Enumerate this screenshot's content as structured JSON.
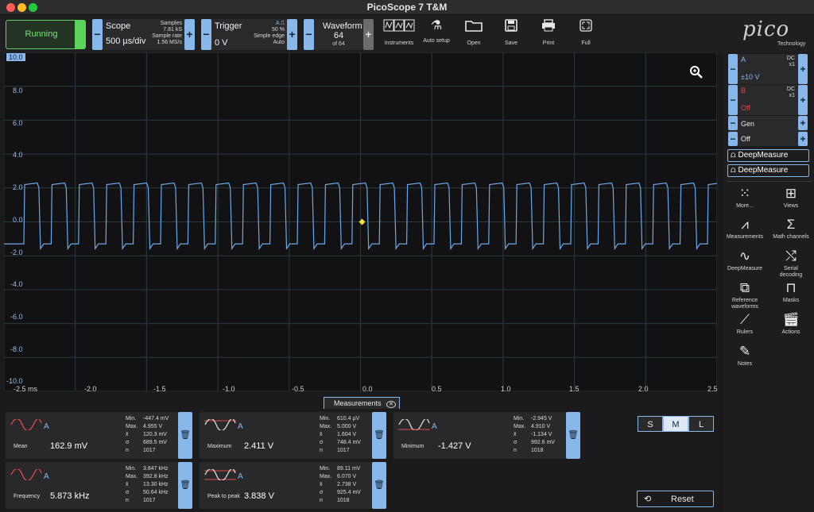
{
  "window": {
    "title": "PicoScope 7 T&M"
  },
  "status": {
    "running_label": "Running"
  },
  "scope": {
    "label": "Scope",
    "timebase": "500 µs/div",
    "samples_label": "Samples",
    "samples_value": "7.81 kS",
    "rate_label": "Sample rate",
    "rate_value": "1.56 MS/s"
  },
  "trigger": {
    "label": "Trigger",
    "level": "0 V",
    "percent": "50 %",
    "mode": "Simple edge",
    "type": "Auto",
    "channel": "A"
  },
  "waveform": {
    "label": "Waveform",
    "current": "64",
    "total": "of 64"
  },
  "tools": [
    {
      "label": "Instruments",
      "icon": "instruments-icon"
    },
    {
      "label": "Auto setup",
      "icon": "wand-icon"
    },
    {
      "label": "Open",
      "icon": "folder-icon"
    },
    {
      "label": "Save",
      "icon": "save-icon"
    },
    {
      "label": "Print",
      "icon": "print-icon"
    },
    {
      "label": "Full",
      "icon": "fullscreen-icon"
    }
  ],
  "logo": {
    "brand": "pico",
    "sub": "Technology"
  },
  "plot": {
    "ytop_marker": "10.0",
    "ybottom_marker": "-10.0",
    "y_ticks": [
      "8.0",
      "6.0",
      "4.0",
      "2.0",
      "0.0",
      "-2.0",
      "-4.0",
      "-6.0",
      "-8.0"
    ],
    "x_ticks": [
      "-2.5 ms",
      "-2.0",
      "-1.5",
      "-1.0",
      "-0.5",
      "0.0",
      "0.5",
      "1.0",
      "1.5",
      "2.0",
      "2.5"
    ],
    "trace_color": "#6fa8e6",
    "grid_color": "#2a3a40",
    "trigger_marker_color": "#f2e24a"
  },
  "channels": {
    "a": {
      "name": "A",
      "coupling": "DC",
      "probe": "x1",
      "range": "±10 V",
      "color": "#8ab7ea"
    },
    "b": {
      "name": "B",
      "coupling": "DC",
      "probe": "x1",
      "range": "Off",
      "color": "#e04a4a"
    },
    "gen": {
      "name": "Gen",
      "state": "Off"
    }
  },
  "deep": [
    "DeepMeasure",
    "DeepMeasure"
  ],
  "right_tools": [
    {
      "label": "More...",
      "icon": "grid-dots-icon"
    },
    {
      "label": "Views",
      "icon": "views-icon"
    },
    {
      "label": "Measurements",
      "icon": "compass-icon"
    },
    {
      "label": "Math channels",
      "icon": "sigma-icon"
    },
    {
      "label": "DeepMeasure",
      "icon": "deepmeasure-icon"
    },
    {
      "label": "Serial decoding",
      "icon": "serial-icon"
    },
    {
      "label": "Reference waveforms",
      "icon": "reference-icon"
    },
    {
      "label": "Masks",
      "icon": "mask-icon"
    },
    {
      "label": "Rulers",
      "icon": "ruler-icon"
    },
    {
      "label": "Actions",
      "icon": "clapper-icon"
    },
    {
      "label": "Notes",
      "icon": "notes-icon"
    }
  ],
  "measurements_tab": "Measurements",
  "measurements": [
    {
      "name": "Mean",
      "value": "162.9 mV",
      "ch": "A",
      "min": "-447.4 mV",
      "max": "4.955 V",
      "avg": "120.3 mV",
      "sd": "689.5 mV",
      "n": "1017"
    },
    {
      "name": "Maximum",
      "value": "2.411 V",
      "ch": "A",
      "min": "610.4 µV",
      "max": "5.000 V",
      "avg": "1.604 V",
      "sd": "748.4 mV",
      "n": "1017"
    },
    {
      "name": "Minimum",
      "value": "-1.427 V",
      "ch": "A",
      "min": "-2.945 V",
      "max": "4.910 V",
      "avg": "-1.134 V",
      "sd": "992.6 mV",
      "n": "1018"
    },
    {
      "name": "Frequency",
      "value": "5.873 kHz",
      "ch": "A",
      "min": "3.847 kHz",
      "max": "392.8 kHz",
      "avg": "13.30 kHz",
      "sd": "50.64 kHz",
      "n": "1017"
    },
    {
      "name": "Peak to peak",
      "value": "3.838 V",
      "ch": "A",
      "min": "89.11 mV",
      "max": "6.070 V",
      "avg": "2.738 V",
      "sd": "925.4 mV",
      "n": "1018"
    }
  ],
  "stat_keys": {
    "min": "Min.",
    "max": "Max.",
    "avg": "x̄",
    "sd": "σ",
    "n": "n"
  },
  "size_buttons": [
    "S",
    "M",
    "L"
  ],
  "reset_label": "Reset"
}
